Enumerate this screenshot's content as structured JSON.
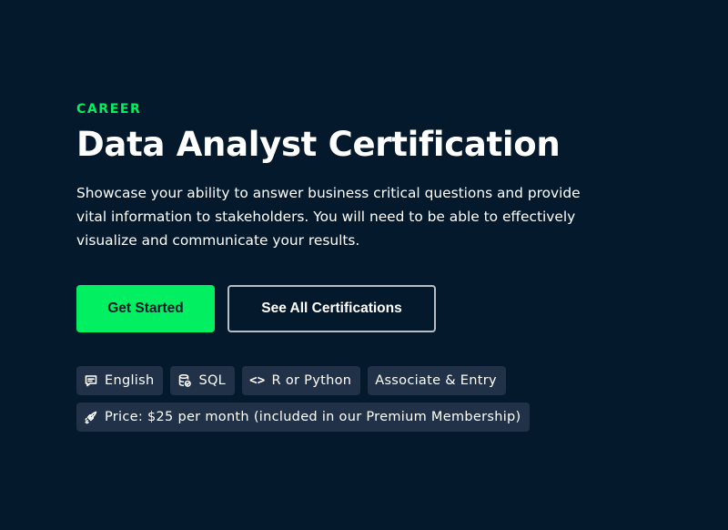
{
  "hero": {
    "eyebrow": "CAREER",
    "title": "Data Analyst Certification",
    "description": "Showcase your ability to answer business critical questions and provide vital information to stakeholders. You will need to be able to effectively visualize and communicate your results."
  },
  "actions": {
    "primary_label": "Get Started",
    "secondary_label": "See All Certifications"
  },
  "tags": {
    "language": {
      "label": "English",
      "icon": "chat-icon"
    },
    "technology": {
      "label": "SQL",
      "icon": "database-icon"
    },
    "programming": {
      "label": "R or Python",
      "icon": "code-icon",
      "glyph": "<>"
    },
    "level": {
      "label": "Associate & Entry"
    },
    "price": {
      "label": "Price: $25 per month (included in our Premium Membership)",
      "icon": "rocket-icon"
    }
  },
  "colors": {
    "background": "#05192d",
    "accent": "#03ef62",
    "tag_background": "#213147",
    "secondary_border": "#b8bec6"
  }
}
